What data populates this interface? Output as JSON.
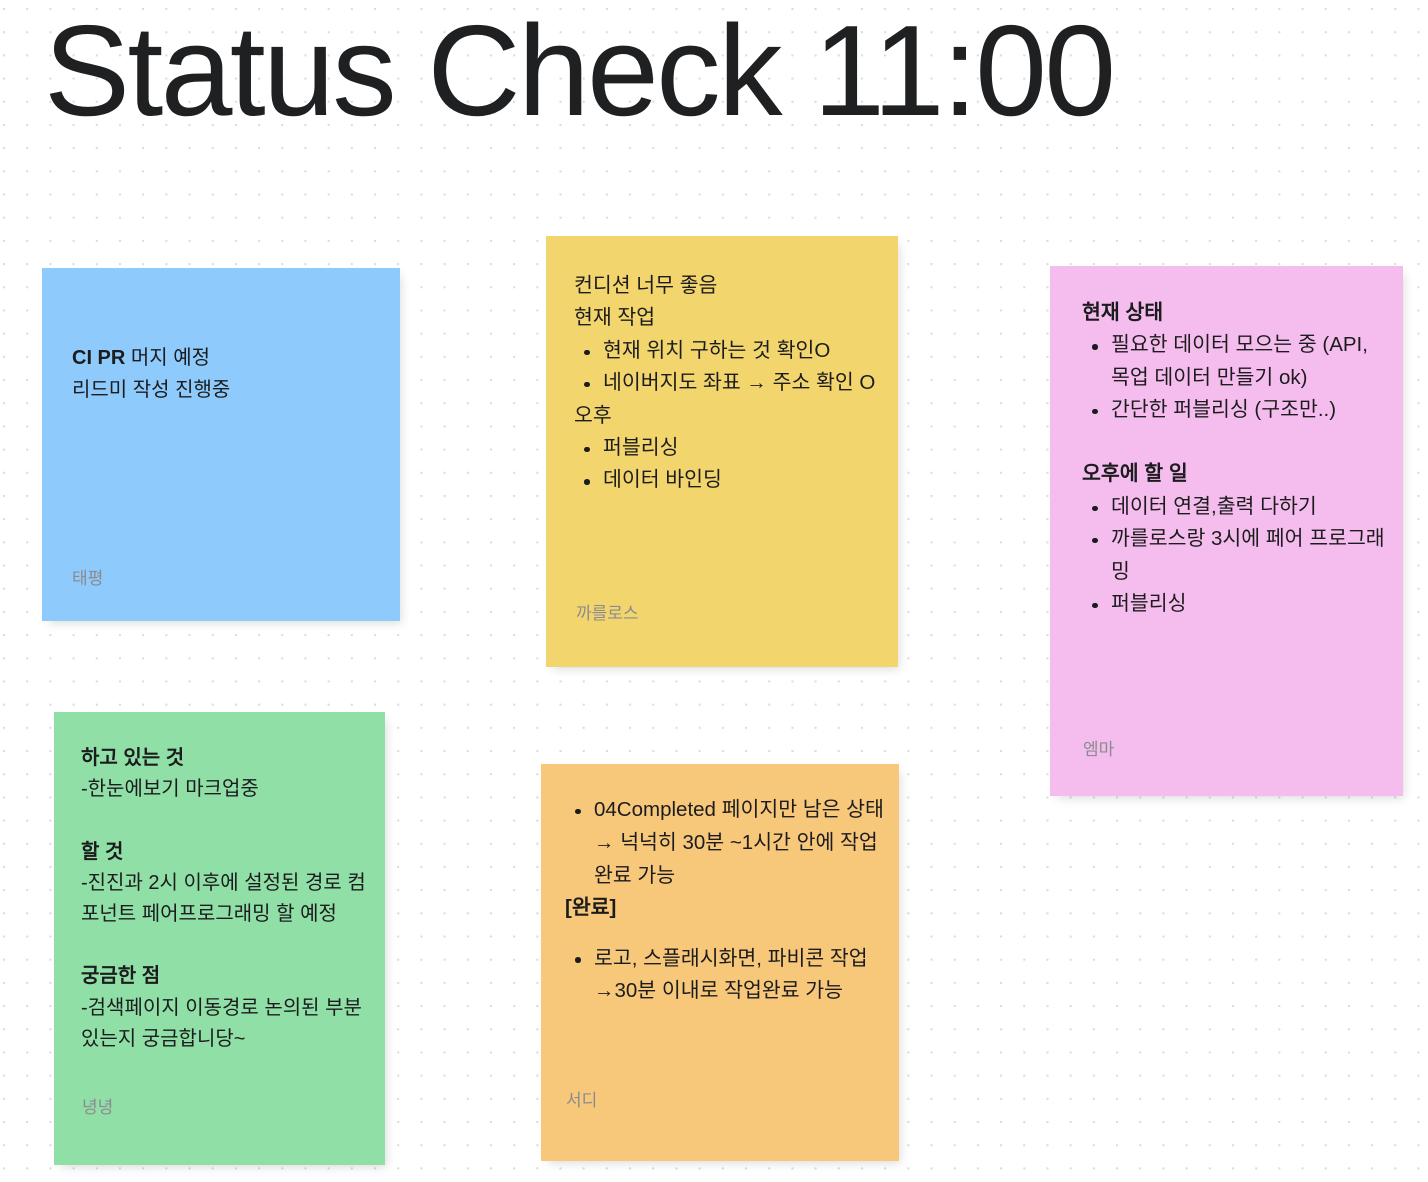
{
  "page": {
    "title": "Status Check 11:00",
    "background_color": "#ffffff",
    "dot_grid_color": "#dcdcdc",
    "title_color": "#1f2022"
  },
  "cards": {
    "blue": {
      "color": "#8ecafb",
      "line1_bold": "CI PR",
      "line1_rest": " 머지 예정",
      "line2": "리드미 작성 진행중",
      "author": "태평"
    },
    "yellow": {
      "color": "#f3d56d",
      "line1": "컨디션 너무 좋음",
      "line2": "현재 작업",
      "bullets1": [
        "현재 위치 구하는 것 확인O",
        "네이버지도 좌표 → 주소 확인 O"
      ],
      "line3": "오후",
      "bullets2": [
        "퍼블리싱",
        "데이터 바인딩"
      ],
      "author": "까를로스"
    },
    "pink": {
      "color": "#f5bdee",
      "heading1": "현재 상태",
      "bullets1": [
        "필요한 데이터 모으는 중 (API, 목업 데이터 만들기 ok)",
        "간단한 퍼블리싱 (구조만..)"
      ],
      "heading2": "오후에 할 일",
      "bullets2": [
        "데이터 연결,출력 다하기",
        "까를로스랑 3시에 페어 프로그래밍",
        "퍼블리싱"
      ],
      "author": "엠마"
    },
    "green": {
      "color": "#90dfa7",
      "heading1": "하고 있는 것",
      "body1": "-한눈에보기 마크업중",
      "heading2": "할 것",
      "body2": "-진진과 2시 이후에 설정된 경로 컴포넌트 페어프로그래밍 할 예정",
      "heading3": "궁금한 점",
      "body3": "-검색페이지 이동경로 논의된 부분있는지 궁금합니당~",
      "author": "녕녕"
    },
    "orange": {
      "color": "#f7c77a",
      "bullets1": [
        "04Completed 페이지만 남은 상태 → 넉넉히 30분 ~1시간 안에 작업완료 가능"
      ],
      "heading1": "[완료]",
      "bullets2": [
        "로고, 스플래시화면, 파비콘 작업 →30분 이내로 작업완료 가능"
      ],
      "author": "서디"
    }
  }
}
